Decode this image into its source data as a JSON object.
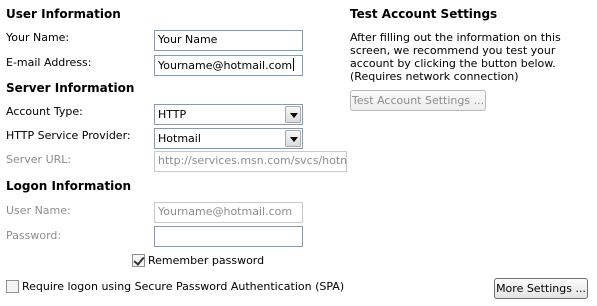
{
  "user_info": {
    "heading": "User Information",
    "your_name_label": "Your Name:",
    "your_name_value": "Your Name",
    "email_label": "E-mail Address:",
    "email_value": "Yourname@hotmail.com"
  },
  "server_info": {
    "heading": "Server Information",
    "account_type_label": "Account Type:",
    "account_type_value": "HTTP",
    "provider_label": "HTTP Service Provider:",
    "provider_value": "Hotmail",
    "server_url_label": "Server URL:",
    "server_url_value": "http://services.msn.com/svcs/hotmail/h"
  },
  "logon_info": {
    "heading": "Logon Information",
    "username_label": "User Name:",
    "username_value": "Yourname@hotmail.com",
    "password_label": "Password:",
    "password_value": "",
    "remember_label": "Remember password",
    "remember_checked": true,
    "spa_label": "Require logon using Secure Password Authentication (SPA)",
    "spa_checked": false
  },
  "test_settings": {
    "heading": "Test Account Settings",
    "description": "After filling out the information on this screen, we recommend you test your account by clicking the button below. (Requires network connection)",
    "test_button_label": "Test Account Settings ..."
  },
  "more_settings_label": "More Settings ...",
  "colors": {
    "field_border": "#7f9db9",
    "disabled_text": "#8d8d8d"
  }
}
